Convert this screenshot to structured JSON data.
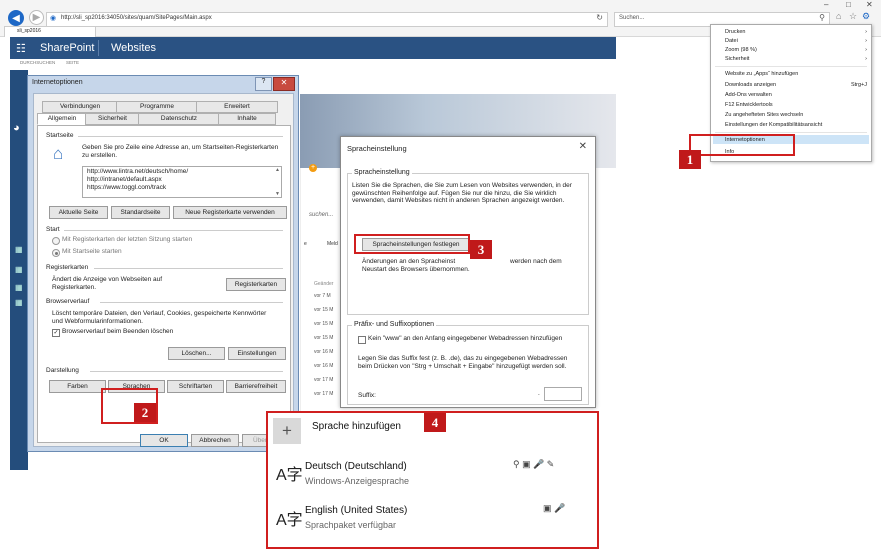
{
  "browser": {
    "url": "http://sli_sp2016:34050/sites/quam/SitePages/Main.aspx",
    "search_placeholder": "Suchen...",
    "tab_title": "sli_sp2016",
    "window_minimize": "–",
    "window_maximize": "□",
    "window_close": "✕"
  },
  "suitebar": {
    "brand": "SharePoint",
    "sites": "Websites",
    "ribbon_browse": "DURCHSUCHEN",
    "ribbon_page": "SEITE"
  },
  "background_page": {
    "search_hint": "suchen...",
    "col_header": "Geänder",
    "col_header2": "Meld",
    "rows": [
      "vor 7 M",
      "vor 15 M",
      "vor 15 M",
      "vor 15 M",
      "vor 16 M",
      "vor 16 M",
      "vor 17 M",
      "vor 17 M"
    ]
  },
  "internet_options": {
    "title": "Internetoptionen",
    "help": "?",
    "close": "✕",
    "tabs_row1": [
      "Verbindungen",
      "Programme",
      "Erweitert"
    ],
    "tabs_row2": [
      "Allgemein",
      "Sicherheit",
      "Datenschutz",
      "Inhalte"
    ],
    "startseite": {
      "heading": "Startseite",
      "desc": "Geben Sie pro Zeile eine Adresse an, um Startseiten-Registerkarten zu erstellen.",
      "urls": [
        "http://www.lintra.net/deutsch/home/",
        "http://intranet/default.aspx",
        "https://www.toggl.com/track"
      ],
      "btn_current": "Aktuelle Seite",
      "btn_default": "Standardseite",
      "btn_newtab": "Neue Registerkarte verwenden"
    },
    "start": {
      "heading": "Start",
      "opt_last": "Mit Registerkarten der letzten Sitzung starten",
      "opt_home": "Mit Startseite starten"
    },
    "registerkarten": {
      "heading": "Registerkarten",
      "desc": "Ändert die Anzeige von Webseiten auf Registerkarten.",
      "btn": "Registerkarten"
    },
    "browserverlauf": {
      "heading": "Browserverlauf",
      "desc": "Löscht temporäre Dateien, den Verlauf, Cookies, gespeicherte Kennwörter und Webformularinformationen.",
      "checkbox": "Browserverlauf beim Beenden löschen",
      "btn_delete": "Löschen...",
      "btn_settings": "Einstellungen"
    },
    "darstellung": {
      "heading": "Darstellung",
      "btn_colors": "Farben",
      "btn_languages": "Sprachen",
      "btn_fonts": "Schriftarten",
      "btn_access": "Barrierefreiheit"
    },
    "btn_ok": "OK",
    "btn_cancel": "Abbrechen",
    "btn_apply": "Über"
  },
  "language_dialog": {
    "title": "Spracheinstellung",
    "close": "✕",
    "group1_legend": "Spracheinstellung",
    "group1_desc": "Listen Sie die Sprachen, die Sie zum Lesen von Websites verwenden, in der gewünschten Reihenfolge auf. Fügen Sie nur die hinzu, die Sie wirklich verwenden, damit Websites nicht in anderen Sprachen angezeigt werden.",
    "btn_set_languages": "Spracheinstellungen festlegen",
    "note_prefix": "Änderungen an den Spracheinst",
    "note_suffix": "werden nach dem",
    "note_line2": "Neustart des Browsers übernommen.",
    "group2_legend": "Präfix- und Suffixoptionen",
    "chk_www": "Kein \"www\" an den Anfang eingegebener Webadressen hinzufügen",
    "suffix_desc": "Legen Sie das Suffix fest (z. B. .de), das zu eingegebenen Webadressen beim Drücken von \"Strg + Umschalt + Eingabe\" hinzugefügt werden soll.",
    "suffix_label": "Suffix:",
    "suffix_value": "."
  },
  "tools_menu": {
    "items": [
      {
        "label": "Drucken",
        "submenu": true
      },
      {
        "label": "Datei",
        "submenu": true
      },
      {
        "label": "Zoom (98 %)",
        "submenu": true
      },
      {
        "label": "Sicherheit",
        "submenu": true
      },
      {
        "label": "Website zu „Apps“ hinzufügen",
        "submenu": false
      },
      {
        "label": "Downloads anzeigen",
        "shortcut": "Strg+J"
      },
      {
        "label": "Add-Ons verwalten"
      },
      {
        "label": "F12 Entwicklertools"
      },
      {
        "label": "Zu angehefteten Sites wechseln"
      },
      {
        "label": "Einstellungen der Kompatibilitätsansicht"
      },
      {
        "label": "Internetoptionen",
        "highlighted": true
      },
      {
        "label": "Info"
      }
    ]
  },
  "windows_language_panel": {
    "add_icon": "+",
    "add_label": "Sprache hinzufügen",
    "languages": [
      {
        "glyph": "A字",
        "name": "Deutsch (Deutschland)",
        "sub": "Windows-Anzeigesprache",
        "icons": "⚲ ▣ 🎤 ✎"
      },
      {
        "glyph": "A字",
        "name": "English (United States)",
        "sub": "Sprachpaket verfügbar",
        "icons": "▣ 🎤"
      }
    ]
  },
  "annotations": {
    "step1": "1",
    "step2": "2",
    "step3": "3",
    "step4": "4",
    "color": "#d01f1f"
  }
}
